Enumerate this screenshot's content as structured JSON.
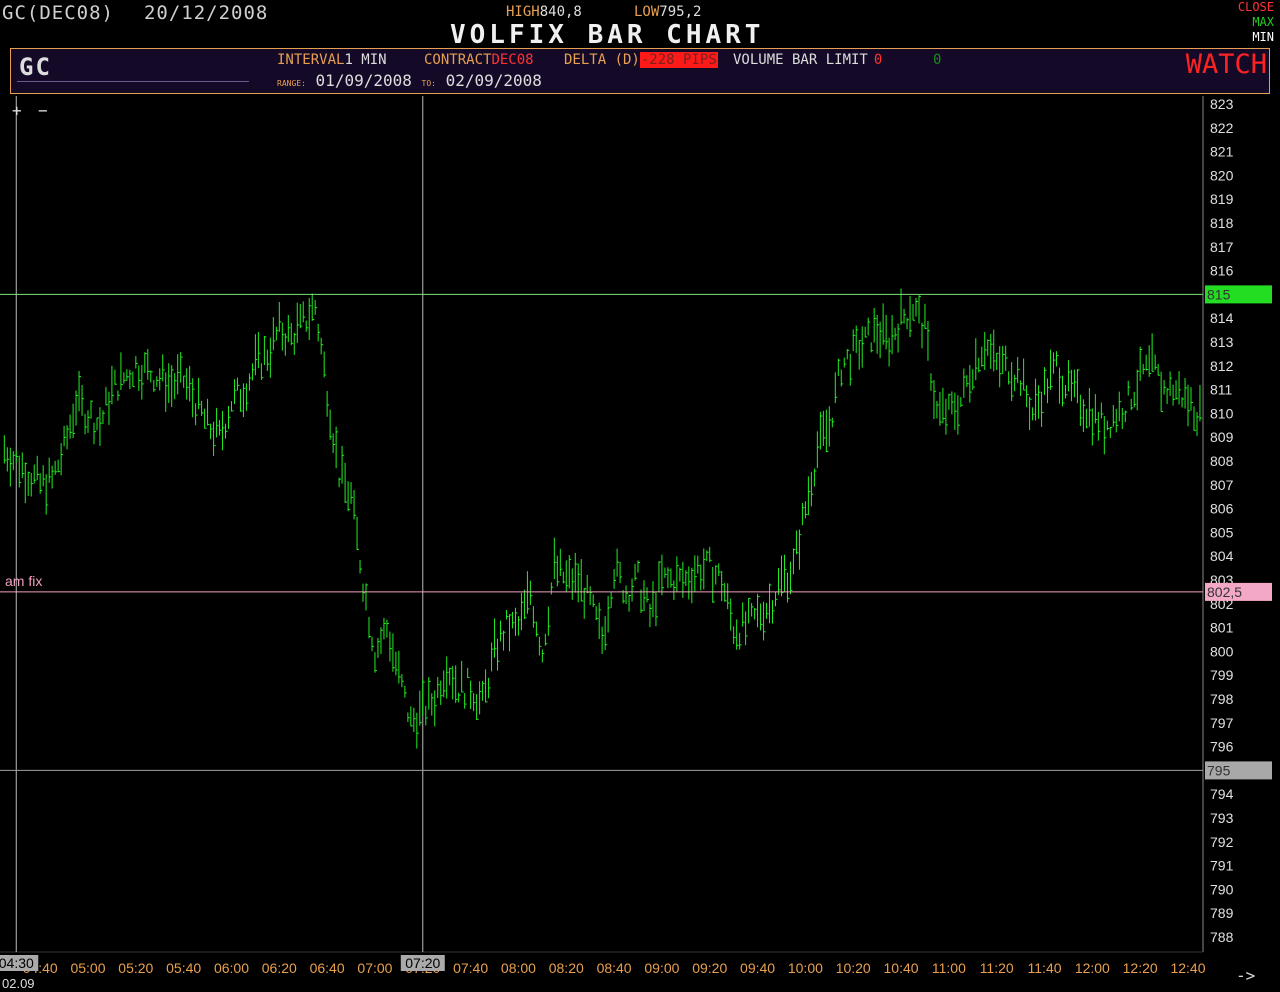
{
  "header": {
    "symbol_contract": "GC(DEC08)",
    "date": "20/12/2008",
    "high_label": "HIGH",
    "high_value": "840,8",
    "low_label": "LOW",
    "low_value": "795,2",
    "title": "VOLFIX BAR CHART",
    "window_controls": [
      "CLOSE",
      "MAX",
      "MIN"
    ]
  },
  "panel": {
    "symbol": "GC",
    "interval_label": "INTERVAL",
    "interval_value": "1 MIN",
    "contract_label": "CONTRACT",
    "contract_value": "DEC08",
    "delta_label": "DELTA (D)",
    "delta_value": "-228 PIPS",
    "volume_label": "VOLUME BAR LIMIT",
    "volume_value": "0",
    "extra_value": "0",
    "range_label": "RANGE:",
    "range_from": "01/09/2008",
    "to_label": "TO:",
    "range_to": "02/09/2008",
    "watch": "WATCH"
  },
  "zoom": {
    "plus": "+",
    "minus": "−"
  },
  "footer": {
    "date": "02.09",
    "arrow": "->"
  },
  "colors": {
    "bars": "#22ee22",
    "high_line": "#7fe37f",
    "low_line": "#a0a0a0",
    "fix_line": "#f0a0c0",
    "accent": "#e8a050"
  },
  "chart_data": {
    "type": "bar",
    "title": "VOLFIX BAR CHART",
    "ylim": [
      787.5,
      823.5
    ],
    "y_ticks": [
      823,
      822,
      821,
      820,
      819,
      818,
      817,
      816,
      815,
      814,
      813,
      812,
      811,
      810,
      809,
      808,
      807,
      806,
      805,
      804,
      803,
      802,
      801,
      800,
      799,
      798,
      797,
      796,
      795,
      794,
      793,
      792,
      791,
      790,
      789,
      788
    ],
    "x_ticks": [
      "04:40",
      "05:00",
      "05:20",
      "05:40",
      "06:00",
      "06:20",
      "06:40",
      "07:00",
      "07:20",
      "07:40",
      "08:00",
      "08:20",
      "08:40",
      "09:00",
      "09:20",
      "09:40",
      "10:00",
      "10:20",
      "10:40",
      "11:00",
      "11:20",
      "11:40",
      "12:00",
      "12:20",
      "12:40"
    ],
    "cursor_times": [
      "04:30",
      "07:20"
    ],
    "hlines": [
      {
        "label": "815",
        "value": 815,
        "color": "#7fe37f",
        "tag_color": "#22dd22"
      },
      {
        "label": "802,5",
        "value": 802.5,
        "color": "#f0a0c0",
        "tag_color": "#f4a8c8",
        "name": "am fix"
      },
      {
        "label": "795",
        "value": 795,
        "color": "#a0a0a0",
        "tag_color": "#a8a8a8"
      }
    ],
    "series": [
      {
        "x": [
          "04:25",
          "04:30",
          "04:35",
          "04:40",
          "04:45",
          "04:50",
          "04:55",
          "05:00",
          "05:05",
          "05:10",
          "05:15",
          "05:20",
          "05:25",
          "05:30",
          "05:35",
          "05:40",
          "05:45",
          "05:50",
          "05:55",
          "06:00",
          "06:05",
          "06:10",
          "06:15",
          "06:20",
          "06:25",
          "06:30",
          "06:35",
          "06:40",
          "06:45",
          "06:50",
          "06:55",
          "07:00",
          "07:05",
          "07:10",
          "07:15",
          "07:20",
          "07:25",
          "07:30",
          "07:35",
          "07:40",
          "07:45",
          "07:50",
          "07:55",
          "08:00",
          "08:05",
          "08:10",
          "08:15",
          "08:20",
          "08:25",
          "08:30",
          "08:35",
          "08:40",
          "08:45",
          "08:50",
          "08:55",
          "09:00",
          "09:05",
          "09:10",
          "09:15",
          "09:20",
          "09:25",
          "09:30",
          "09:35",
          "09:40",
          "09:45",
          "09:50",
          "09:55",
          "10:00",
          "10:05",
          "10:10",
          "10:15",
          "10:20",
          "10:25",
          "10:30",
          "10:35",
          "10:40",
          "10:45",
          "10:50",
          "10:55",
          "11:00",
          "11:05",
          "11:10",
          "11:15",
          "11:20",
          "11:25",
          "11:30",
          "11:35",
          "11:40",
          "11:45",
          "11:50",
          "11:55",
          "12:00",
          "12:05",
          "12:10",
          "12:15",
          "12:20",
          "12:25",
          "12:30",
          "12:35",
          "12:40",
          "12:45",
          "12:50",
          "12:55"
        ],
        "values": [
          808.5,
          808.0,
          807.5,
          807.0,
          807.2,
          808.5,
          810.5,
          810.0,
          809.5,
          811.0,
          811.5,
          812.0,
          811.8,
          811.5,
          811.2,
          811.4,
          810.5,
          809.5,
          809.0,
          810.5,
          811.0,
          812.0,
          812.5,
          813.5,
          813.2,
          813.8,
          814.5,
          811.0,
          807.5,
          806.5,
          803.0,
          800.0,
          801.0,
          799.0,
          797.0,
          797.5,
          798.0,
          799.5,
          798.5,
          798.5,
          797.8,
          800.0,
          801.0,
          801.0,
          802.5,
          800.0,
          803.5,
          803.0,
          803.0,
          802.0,
          800.5,
          803.5,
          802.5,
          803.0,
          801.5,
          803.0,
          803.0,
          803.0,
          803.5,
          803.5,
          803.0,
          801.0,
          801.0,
          801.5,
          802.0,
          803.0,
          803.5,
          806.0,
          808.5,
          809.5,
          812.0,
          812.5,
          813.0,
          813.5,
          813.0,
          814.0,
          814.5,
          813.5,
          810.0,
          810.0,
          810.5,
          812.0,
          813.0,
          812.0,
          812.0,
          811.5,
          810.0,
          811.0,
          812.0,
          811.0,
          810.5,
          810.0,
          809.5,
          810.0,
          810.5,
          811.5,
          812.0,
          811.0,
          811.0,
          810.5,
          810.0,
          809.5,
          810.0
        ]
      }
    ]
  }
}
